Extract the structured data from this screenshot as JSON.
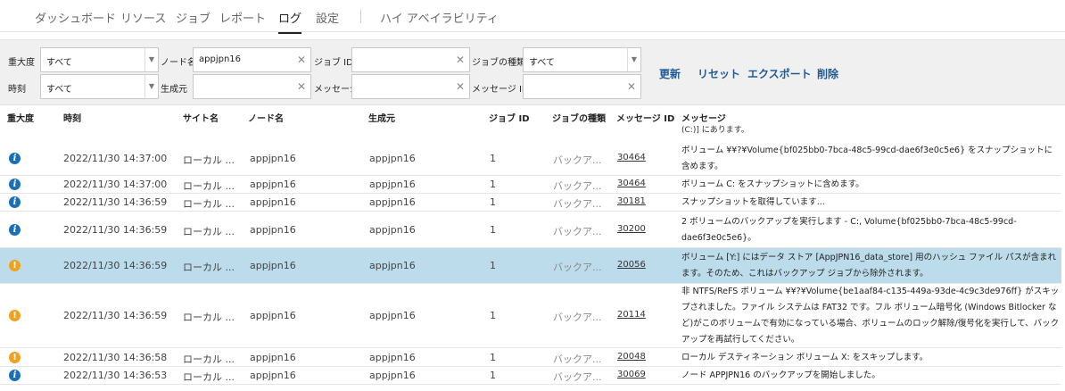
{
  "nav": {
    "tabs": [
      {
        "label": "ダッシュボード"
      },
      {
        "label": "リソース"
      },
      {
        "label": "ジョブ"
      },
      {
        "label": "レポート"
      },
      {
        "label": "ログ"
      },
      {
        "label": "設定"
      },
      {
        "label": "ハイ アベイラビリティ"
      }
    ],
    "active": "ログ"
  },
  "filters": {
    "severity_label": "重大度",
    "severity_value": "すべて",
    "node_label": "ノード名",
    "node_value": "appjpn16",
    "jobid_label": "ジョブ ID",
    "jobid_value": "",
    "jobtype_label": "ジョブの種類",
    "jobtype_value": "すべて",
    "time_label": "時刻",
    "time_value": "すべて",
    "source_label": "生成元",
    "source_value": "",
    "message_label": "メッセージ",
    "message_value": "",
    "msgid_label": "メッセージ ID",
    "msgid_value": ""
  },
  "actions": {
    "refresh": "更新",
    "reset": "リセット",
    "export": "エクスポート",
    "delete": "削除"
  },
  "table": {
    "headers": {
      "severity": "重大度",
      "time": "時刻",
      "site": "サイト名",
      "node": "ノード名",
      "source": "生成元",
      "jobid": "ジョブ ID",
      "jobtype": "ジョブの種類",
      "msgid": "メッセージ ID",
      "message": "メッセージ"
    },
    "continued_message": "(C:)] にあります。",
    "rows": [
      {
        "severity": "info",
        "time": "2022/11/30 14:37:00",
        "site": "ローカル ...",
        "node": "appjpn16",
        "source": "appjpn16",
        "jobid": "1",
        "jobtype": "バックア...",
        "msgid": "30464",
        "message": "ボリューム ¥¥?¥Volume{bf025bb0-7bca-48c5-99cd-dae6f3e0c5e6} をスナップショットに含めます。"
      },
      {
        "severity": "info",
        "time": "2022/11/30 14:37:00",
        "site": "ローカル ...",
        "node": "appjpn16",
        "source": "appjpn16",
        "jobid": "1",
        "jobtype": "バックア...",
        "msgid": "30464",
        "message": "ボリューム C: をスナップショットに含めます。"
      },
      {
        "severity": "info",
        "time": "2022/11/30 14:36:59",
        "site": "ローカル ...",
        "node": "appjpn16",
        "source": "appjpn16",
        "jobid": "1",
        "jobtype": "バックア...",
        "msgid": "30181",
        "message": "スナップショットを取得しています..."
      },
      {
        "severity": "info",
        "time": "2022/11/30 14:36:59",
        "site": "ローカル ...",
        "node": "appjpn16",
        "source": "appjpn16",
        "jobid": "1",
        "jobtype": "バックア...",
        "msgid": "30200",
        "message": "2 ボリュームのバックアップを実行します - C:, Volume{bf025bb0-7bca-48c5-99cd-dae6f3e0c5e6}。"
      },
      {
        "severity": "warn",
        "time": "2022/11/30 14:36:59",
        "site": "ローカル ...",
        "node": "appjpn16",
        "source": "appjpn16",
        "jobid": "1",
        "jobtype": "バックア...",
        "msgid": "20056",
        "message": "ボリューム [Y:] にはデータ ストア [AppJPN16_data_store] 用のハッシュ ファイル パスが含まれます。そのため、これはバックアップ ジョブから除外されます。"
      },
      {
        "severity": "warn",
        "time": "2022/11/30 14:36:59",
        "site": "ローカル ...",
        "node": "appjpn16",
        "source": "appjpn16",
        "jobid": "1",
        "jobtype": "バックア...",
        "msgid": "20114",
        "message": "非 NTFS/ReFS ボリューム ¥¥?¥Volume{be1aaf84-c135-449a-93de-4c9c3de976ff} がスキップされました。ファイル システムは FAT32 です。フル ボリューム暗号化 (Windows Bitlocker など)がこのボリュームで有効になっている場合、ボリュームのロック解除/復号化を実行して、バックアップを再試行してください。"
      },
      {
        "severity": "warn",
        "time": "2022/11/30 14:36:58",
        "site": "ローカル ...",
        "node": "appjpn16",
        "source": "appjpn16",
        "jobid": "1",
        "jobtype": "バックア...",
        "msgid": "20048",
        "message": "ローカル デスティネーション ボリューム X: をスキップします。"
      },
      {
        "severity": "info",
        "time": "2022/11/30 14:36:53",
        "site": "ローカル ...",
        "node": "appjpn16",
        "source": "appjpn16",
        "jobid": "1",
        "jobtype": "バックア...",
        "msgid": "30069",
        "message": "ノード APPJPN16 のバックアップを開始しました。"
      }
    ],
    "selected_index": 4
  },
  "icons": {
    "info": "info-icon",
    "warn": "warning-icon",
    "clear": "clear-icon",
    "dropdown": "chevron-down-icon"
  },
  "colors": {
    "info": "#1b6fb8",
    "warn": "#f0a21e",
    "selected_row": "#bcdcec",
    "action_link": "#1f5a96"
  }
}
